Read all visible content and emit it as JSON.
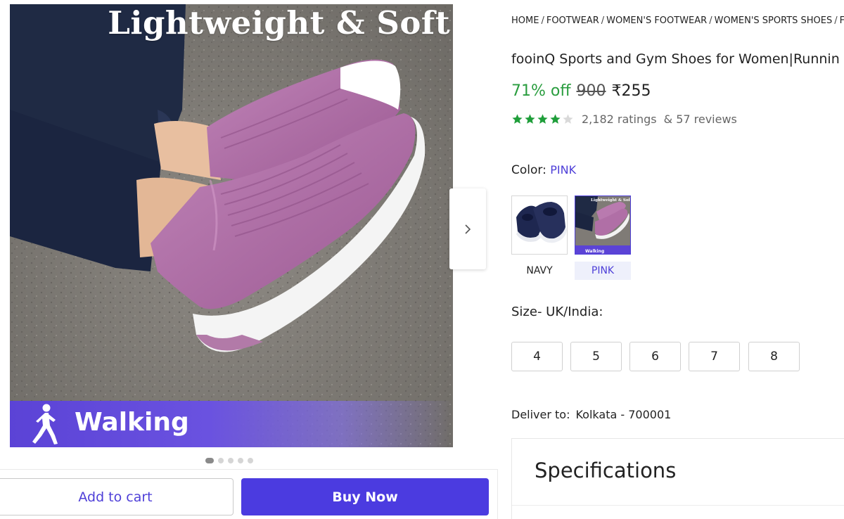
{
  "gallery": {
    "headline": "Lightweight & Soft",
    "banner_label": "Walking",
    "next_icon": "chevron-right-icon",
    "dots": {
      "count": 5,
      "active_index": 0
    }
  },
  "actions": {
    "add_to_cart": "Add to cart",
    "buy_now": "Buy Now"
  },
  "breadcrumb": [
    "HOME",
    "FOOTWEAR",
    "WOMEN'S FOOTWEAR",
    "WOMEN'S SPORTS SHOES",
    "FO"
  ],
  "product": {
    "title": "fooinQ Sports and Gym Shoes for Women|Runnin",
    "discount": "71% off",
    "mrp": "900",
    "price": "₹255",
    "rating_value": 4,
    "rating_max": 5,
    "ratings_text": "2,182 ratings",
    "reviews_text": "& 57 reviews"
  },
  "color": {
    "label": "Color:",
    "selected": "PINK",
    "options": [
      {
        "label": "NAVY",
        "selected": false
      },
      {
        "label": "PINK",
        "selected": true
      }
    ]
  },
  "size": {
    "label": "Size- UK/India:",
    "options": [
      "4",
      "5",
      "6",
      "7",
      "8"
    ]
  },
  "delivery": {
    "label": "Deliver to:",
    "location": "Kolkata - 700001"
  },
  "specifications": {
    "title": "Specifications"
  },
  "colors": {
    "accent": "#4b3be0",
    "discount": "#2a9d3f",
    "star": "#1f9e3a"
  }
}
